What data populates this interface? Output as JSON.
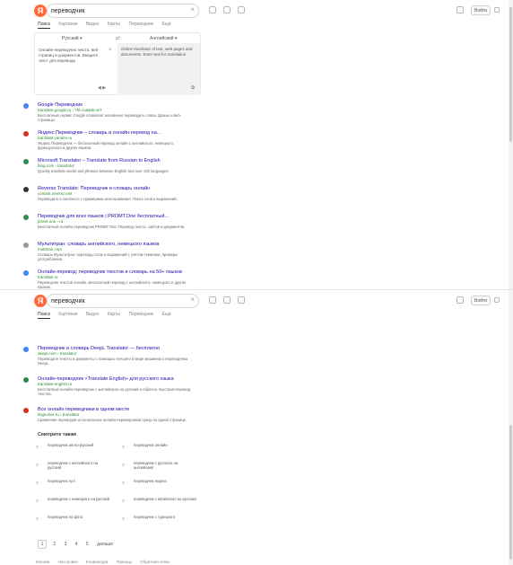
{
  "header": {
    "logo_letter": "Я",
    "query": "переводчик",
    "clear": "×",
    "sign_in": "Войти",
    "tabs": [
      "Поиск",
      "Картинки",
      "Видео",
      "Карты",
      "Переводчик",
      "Ещё"
    ]
  },
  "translator": {
    "from_lang": "Русский ▾",
    "swap": "⇄",
    "to_lang": "Английский ▾",
    "source_text": "Онлайн-переводчик текста, веб-страниц и документов. Введите текст для перевода",
    "clear": "×",
    "result_text": "Online translator of text, web pages and documents. Enter text for translation",
    "icons": "◀ ▶",
    "copy": "⧉"
  },
  "results_top": [
    {
      "title": "Google Переводчик",
      "url": "translate.google.ru › ?hl=ru&tab=wT",
      "snippet": "Бесплатный сервис Google позволяет мгновенно переводить слова, фразы и веб-страницы.",
      "color": "#4285f4"
    },
    {
      "title": "Яндекс Переводчик – словарь и онлайн-перевод на…",
      "url": "translate.yandex.ru",
      "snippet": "Яндекс Переводчик — бесплатный перевод онлайн с английского, немецкого, французского и других языков.",
      "color": "#d93025"
    },
    {
      "title": "Microsoft Translator – Translate from Russian to English",
      "url": "bing.com › translator",
      "snippet": "Quickly translate words and phrases between English and over 100 languages.",
      "color": "#2e8b57"
    },
    {
      "title": "Reverso Translate: Переводчик и словарь онлайн",
      "url": "context.reverso.net",
      "snippet": "Переводите в контексте с примерами использования. Поиск слов и выражений.",
      "color": "#333333"
    },
    {
      "title": "Переводчик для всех языков | PROMT.One бесплатный…",
      "url": "promt.one › ru",
      "snippet": "Бесплатный онлайн-переводчик PROMT.One. Перевод текста, сайтов и документов.",
      "color": "#2e8b57"
    },
    {
      "title": "Мультитран: словарь английского, немецкого языков",
      "url": "multitran.com",
      "snippet": "Словарь Мультитран: переводы слов и выражений с учётом тематики, примеры употребления.",
      "color": "#999999"
    },
    {
      "title": "Онлайн-перевод: переводчик текстов и словарь на 50+ языков",
      "url": "translate.ru",
      "snippet": "Переводчик текстов онлайн. Бесплатный перевод с английского, немецкого и других языков.",
      "color": "#4285f4"
    }
  ],
  "results_bottom": [
    {
      "title": "Переводчик и словарь DeepL Translator — бесплатно",
      "url": "deepl.com › translator",
      "snippet": "Переводите тексты и документы с помощью лучшего в мире машинного переводчика DeepL.",
      "color": "#4285f4"
    },
    {
      "title": "Онлайн-переводчик «Translate English» для русского языка",
      "url": "translate-english.ru",
      "snippet": "Бесплатный онлайн-переводчик с английского на русский и обратно. Быстрый перевод текстов.",
      "color": "#2e8b57"
    },
    {
      "title": "Все онлайн переводчики в одном месте",
      "url": "lingvolive.ru › translator",
      "snippet": "Сравнение переводов из нескольких онлайн-переводчиков сразу на одной странице.",
      "color": "#d93025"
    }
  ],
  "related": {
    "heading": "Смотрите также",
    "items": [
      "переводчик англо-русский",
      "переводчик онлайн",
      "переводчик с английского на русский",
      "переводчик с русского на английский",
      "переводчик гугл",
      "переводчик яндекс",
      "переводчик с немецкого на русский",
      "переводчик с китайского на русский",
      "переводчик по фото",
      "переводчик с турецкого"
    ]
  },
  "pager": {
    "pages": [
      "1",
      "2",
      "3",
      "4",
      "5"
    ],
    "next": "дальше"
  },
  "footer": {
    "links": [
      "Москва",
      "Настройки",
      "Клавиатура",
      "Помощь",
      "Обратная связь"
    ]
  }
}
